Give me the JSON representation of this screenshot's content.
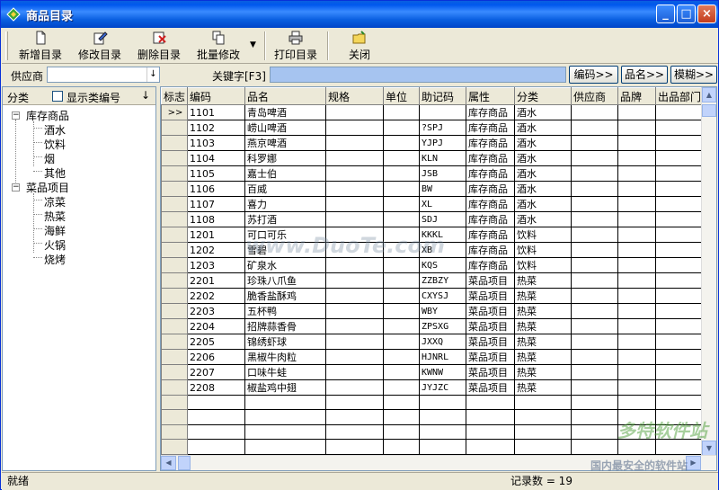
{
  "window": {
    "title": "商品目录"
  },
  "toolbar": {
    "buttons": [
      {
        "label": "新增目录",
        "icon": "new-document-icon"
      },
      {
        "label": "修改目录",
        "icon": "edit-document-icon"
      },
      {
        "label": "删除目录",
        "icon": "delete-document-icon"
      },
      {
        "label": "批量修改",
        "icon": "batch-edit-icon"
      },
      {
        "label": "打印目录",
        "icon": "printer-icon"
      },
      {
        "label": "关闭",
        "icon": "close-folder-icon"
      }
    ]
  },
  "filter": {
    "supplier_label": "供应商",
    "supplier_value": "",
    "keyword_label": "关键字[F3]",
    "keyword_value": "",
    "btn_code": "编码>>",
    "btn_name": "品名>>",
    "btn_fuzzy": "模糊>>"
  },
  "category_panel": {
    "header_label": "分类",
    "show_code_label": "显示类编号",
    "show_code_checked": false,
    "tree": [
      {
        "label": "库存商品",
        "expanded": true,
        "children": [
          "酒水",
          "饮料",
          "烟",
          "其他"
        ]
      },
      {
        "label": "菜品项目",
        "expanded": true,
        "children": [
          "凉菜",
          "热菜",
          "海鲜",
          "火锅",
          "烧烤"
        ]
      }
    ]
  },
  "grid": {
    "columns": [
      "标志",
      "编码",
      "品名",
      "规格",
      "单位",
      "助记码",
      "属性",
      "分类",
      "供应商",
      "品牌",
      "出品部门"
    ],
    "current_row_marker": ">>",
    "rows": [
      {
        "code": "1101",
        "name": "青岛啤酒",
        "mnemonic": "",
        "attr": "库存商品",
        "category": "酒水"
      },
      {
        "code": "1102",
        "name": "崂山啤酒",
        "mnemonic": "?SPJ",
        "attr": "库存商品",
        "category": "酒水"
      },
      {
        "code": "1103",
        "name": "燕京啤酒",
        "mnemonic": "YJPJ",
        "attr": "库存商品",
        "category": "酒水"
      },
      {
        "code": "1104",
        "name": "科罗娜",
        "mnemonic": "KLN",
        "attr": "库存商品",
        "category": "酒水"
      },
      {
        "code": "1105",
        "name": "嘉士伯",
        "mnemonic": "JSB",
        "attr": "库存商品",
        "category": "酒水"
      },
      {
        "code": "1106",
        "name": "百威",
        "mnemonic": "BW",
        "attr": "库存商品",
        "category": "酒水"
      },
      {
        "code": "1107",
        "name": "喜力",
        "mnemonic": "XL",
        "attr": "库存商品",
        "category": "酒水"
      },
      {
        "code": "1108",
        "name": "苏打酒",
        "mnemonic": "SDJ",
        "attr": "库存商品",
        "category": "酒水"
      },
      {
        "code": "1201",
        "name": "可口可乐",
        "mnemonic": "KKKL",
        "attr": "库存商品",
        "category": "饮料"
      },
      {
        "code": "1202",
        "name": "雪碧",
        "mnemonic": "XB",
        "attr": "库存商品",
        "category": "饮料"
      },
      {
        "code": "1203",
        "name": "矿泉水",
        "mnemonic": "KQS",
        "attr": "库存商品",
        "category": "饮料"
      },
      {
        "code": "2201",
        "name": "珍珠八爪鱼",
        "mnemonic": "ZZBZY",
        "attr": "菜品项目",
        "category": "热菜"
      },
      {
        "code": "2202",
        "name": "脆香盐酥鸡",
        "mnemonic": "CXYSJ",
        "attr": "菜品项目",
        "category": "热菜"
      },
      {
        "code": "2203",
        "name": "五杯鸭",
        "mnemonic": "WBY",
        "attr": "菜品项目",
        "category": "热菜"
      },
      {
        "code": "2204",
        "name": "招牌蒜香骨",
        "mnemonic": "ZPSXG",
        "attr": "菜品项目",
        "category": "热菜"
      },
      {
        "code": "2205",
        "name": "锦绣虾球",
        "mnemonic": "JXXQ",
        "attr": "菜品项目",
        "category": "热菜"
      },
      {
        "code": "2206",
        "name": "黑椒牛肉粒",
        "mnemonic": "HJNRL",
        "attr": "菜品项目",
        "category": "热菜"
      },
      {
        "code": "2207",
        "name": "口味牛蛙",
        "mnemonic": "KWNW",
        "attr": "菜品项目",
        "category": "热菜"
      },
      {
        "code": "2208",
        "name": "椒盐鸡中翅",
        "mnemonic": "JYJZC",
        "attr": "菜品项目",
        "category": "热菜"
      }
    ],
    "empty_rows": 5
  },
  "status": {
    "state": "就绪",
    "record_count_label": "记录数 = 19"
  },
  "watermarks": {
    "center": "www.DuoTe.com",
    "corner_brand": "多特软件站",
    "corner_sub": "国内最安全的软件站"
  },
  "colors": {
    "titlebar": "#0a5fe0",
    "keyword_field": "#a6c4f0",
    "chrome": "#ece9d8"
  }
}
